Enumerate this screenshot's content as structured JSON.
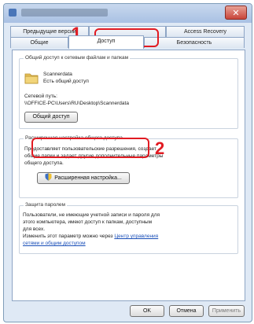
{
  "colors": {
    "accent": "#e11b22",
    "link": "#1a4fb8"
  },
  "tabs_top": [
    {
      "label": "Предыдущие версии"
    },
    {
      "label": "Access Recovery"
    }
  ],
  "tabs_bottom": [
    {
      "label": "Общие"
    },
    {
      "label": "Доступ"
    },
    {
      "label": "Безопасность"
    }
  ],
  "sharing": {
    "group_title": "Общий доступ к сетевым файлам и папкам",
    "folder_name": "Scannerdata",
    "folder_status": "Есть общий доступ",
    "path_label": "Сетевой путь:",
    "path_value": "\\\\OFFICE-PC\\Users\\RU\\Desktop\\Scannerdata",
    "share_button": "Общий доступ"
  },
  "advanced": {
    "group_title": "Расширенная настройка общего доступа",
    "description_1": "Предоставляет пользовательские разрешения, создает",
    "description_2": "общие папки и задает другие дополнительные параметры",
    "description_3": "общего доступа.",
    "button": "Расширенная настройка..."
  },
  "password": {
    "group_title": "Защита паролем",
    "line_1": "Пользователи, не имеющие учетной записи и пароля для",
    "line_2": "этого компьютера, имеют доступ к папкам, доступным",
    "line_3": "для всех.",
    "line_4": "Изменить этот параметр можно через",
    "link_1": "Центр управления",
    "link_2": "сетями и общим доступом"
  },
  "buttons": {
    "ok": "OK",
    "cancel": "Отмена",
    "apply": "Применить"
  },
  "callouts": {
    "step1": "1",
    "step2": "2"
  }
}
